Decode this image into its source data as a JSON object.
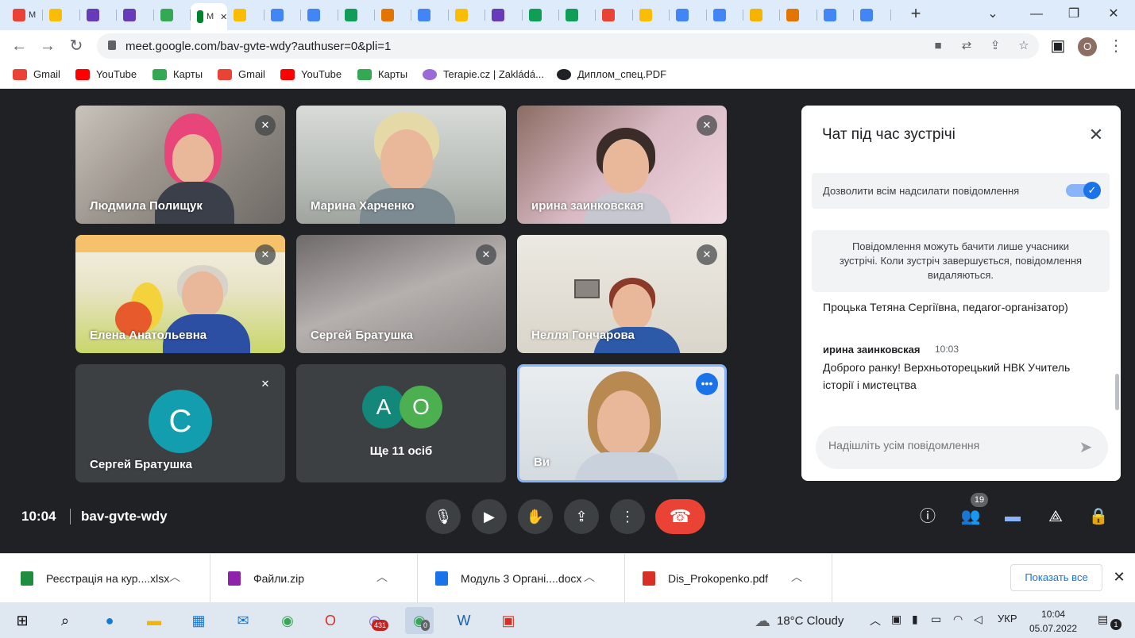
{
  "browser": {
    "tabs": [
      {
        "label": "M",
        "color": "#ea4335"
      },
      {
        "label": "",
        "color": "#fbbc04"
      },
      {
        "label": "",
        "color": "#673ab7"
      },
      {
        "label": "",
        "color": "#673ab7"
      },
      {
        "label": "",
        "color": "#34a853"
      },
      {
        "label": "M",
        "color": "#ffffff",
        "active": true
      },
      {
        "label": "",
        "color": "#fbbc04"
      },
      {
        "label": "",
        "color": "#4285f4"
      },
      {
        "label": "",
        "color": "#4285f4"
      },
      {
        "label": "",
        "color": "#0f9d58"
      },
      {
        "label": "",
        "color": "#e37400"
      },
      {
        "label": "",
        "color": "#4285f4"
      },
      {
        "label": "",
        "color": "#fbbc04"
      },
      {
        "label": "",
        "color": "#673ab7"
      },
      {
        "label": "",
        "color": "#0f9d58"
      },
      {
        "label": "",
        "color": "#0f9d58"
      },
      {
        "label": "",
        "color": "#ea4335"
      },
      {
        "label": "",
        "color": "#fbbc04"
      },
      {
        "label": "",
        "color": "#4285f4"
      },
      {
        "label": "",
        "color": "#4285f4"
      },
      {
        "label": "",
        "color": "#f4b400"
      },
      {
        "label": "",
        "color": "#e37400"
      },
      {
        "label": "",
        "color": "#4285f4"
      },
      {
        "label": "",
        "color": "#4285f4"
      }
    ],
    "url": "meet.google.com/bav-gvte-wdy?authuser=0&pli=1",
    "profile_initial": "O",
    "bookmarks": [
      {
        "label": "Gmail",
        "color": "#ea4335"
      },
      {
        "label": "YouTube",
        "color": "#ff0000"
      },
      {
        "label": "Карты",
        "color": "#34a853"
      },
      {
        "label": "Gmail",
        "color": "#ea4335"
      },
      {
        "label": "YouTube",
        "color": "#ff0000"
      },
      {
        "label": "Карты",
        "color": "#34a853"
      },
      {
        "label": "Terapie.cz | Zakládá...",
        "color": "#9c6ad6"
      },
      {
        "label": "Диплом_спец.PDF",
        "color": "#202124"
      }
    ]
  },
  "meet": {
    "tiles": [
      {
        "name": "Людмила Полищук",
        "muted": true
      },
      {
        "name": "Марина Харченко",
        "muted": false
      },
      {
        "name": "ирина заинковская",
        "muted": true
      },
      {
        "name": "Елена Анатольевна",
        "muted": true
      },
      {
        "name": "Сергей Братушка",
        "muted": true
      },
      {
        "name": "Нелля Гончарова",
        "muted": true
      },
      {
        "name": "Сергей Братушка",
        "muted": true,
        "avatar": "C"
      },
      {
        "name": "Ще 11 осіб",
        "avatars": [
          "A",
          "O"
        ]
      },
      {
        "name": "Ви",
        "self": true
      }
    ],
    "time": "10:04",
    "meeting_code": "bav-gvte-wdy",
    "participants_count": "19",
    "colors": {
      "hangup": "#ea4335",
      "accent": "#1a73e8"
    }
  },
  "chat": {
    "title": "Чат під час зустрічі",
    "allow_label": "Дозволити всім надсилати повідомлення",
    "allow_enabled": true,
    "notice": "Повідомлення можуть бачити лише учасники зустрічі. Коли зустріч завершується, повідомлення видаляються.",
    "prev_message_tail": "Процька Тетяна Сергіївна, педагог-організатор)",
    "messages": [
      {
        "sender": "ирина заинковская",
        "time": "10:03",
        "text": "Доброго ранку! Верхньоторецький НВК Учитель історії і мистецтва"
      }
    ],
    "input_placeholder": "Надішліть усім повідомлення"
  },
  "downloads": {
    "items": [
      {
        "name": "Реєстрація на кур....xlsx",
        "color": "#1e8e3e"
      },
      {
        "name": "Файли.zip",
        "color": "#8e24aa"
      },
      {
        "name": "Модуль 3 Органі....docx",
        "color": "#1a73e8"
      },
      {
        "name": "Dis_Prokopenko.pdf",
        "color": "#d93025"
      }
    ],
    "show_all": "Показать все"
  },
  "taskbar": {
    "weather": "18°C  Cloudy",
    "language": "УКР",
    "time": "10:04",
    "date": "05.07.2022",
    "viber_badge": "431",
    "chrome_badge": "0",
    "notifications": "1"
  }
}
